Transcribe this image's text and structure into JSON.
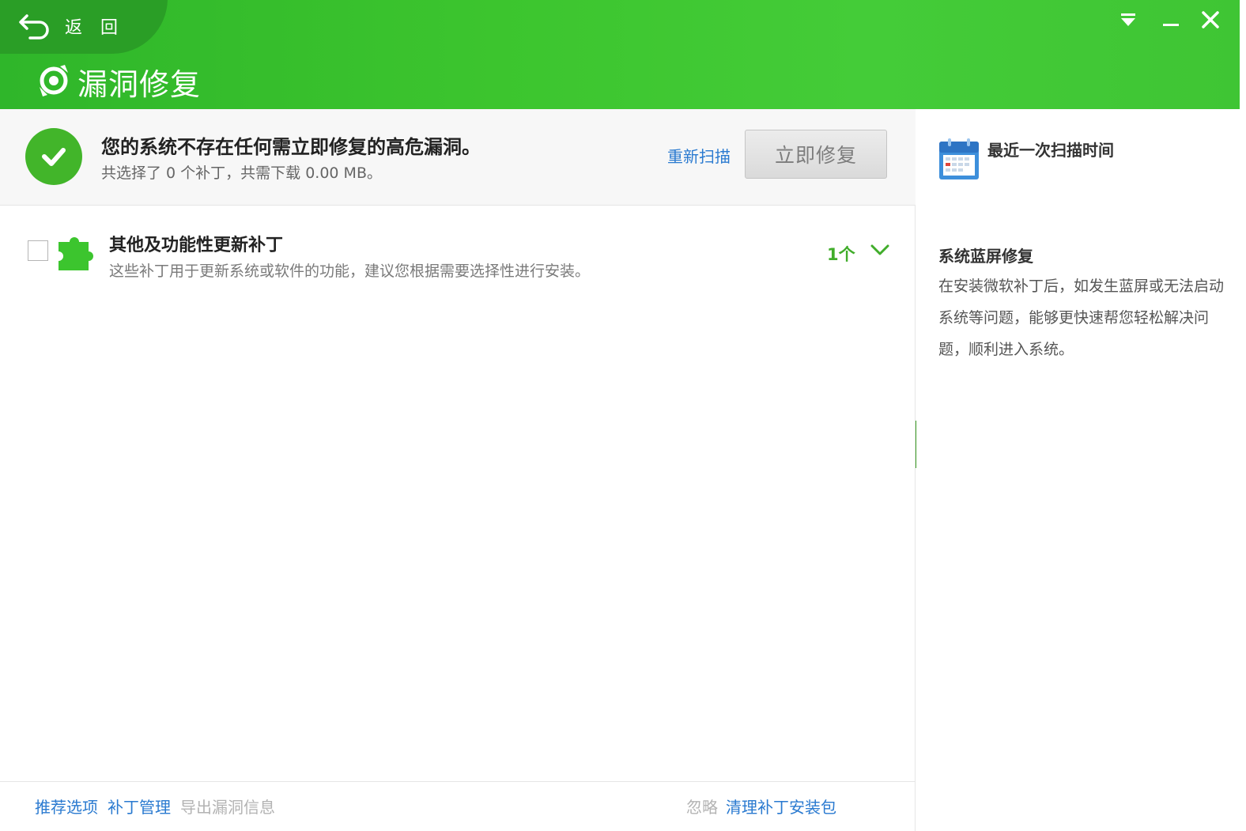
{
  "header": {
    "back_label": "返 回",
    "title": "漏洞修复",
    "colors": {
      "brand_green": "#3cc52e",
      "back_tab": "#2a9e26"
    }
  },
  "window_controls": {
    "menu_icon": "dropdown-menu-icon",
    "minimize_icon": "minimize-icon",
    "close_icon": "close-icon"
  },
  "status": {
    "title": "您的系统不存在任何需立即修复的高危漏洞。",
    "subtitle": "共选择了 0 个补丁，共需下载 0.00 MB。",
    "rescan_label": "重新扫描",
    "fix_button_label": "立即修复"
  },
  "patch_groups": [
    {
      "title": "其他及功能性更新补丁",
      "description": "这些补丁用于更新系统或软件的功能，建议您根据需要选择性进行安装。",
      "count": "1个",
      "checked": false
    }
  ],
  "footer": {
    "left_links": [
      "推荐选项",
      "补丁管理"
    ],
    "export_label": "导出漏洞信息",
    "ignore_label": "忽略",
    "clean_label": "清理补丁安装包"
  },
  "side_panel": {
    "last_scan_label": "最近一次扫描时间",
    "bsod_title": "系统蓝屏修复",
    "bsod_desc": "在安装微软补丁后，如发生蓝屏或无法启动系统等问题，能够更快速帮您轻松解决问题，顺利进入系统。"
  }
}
